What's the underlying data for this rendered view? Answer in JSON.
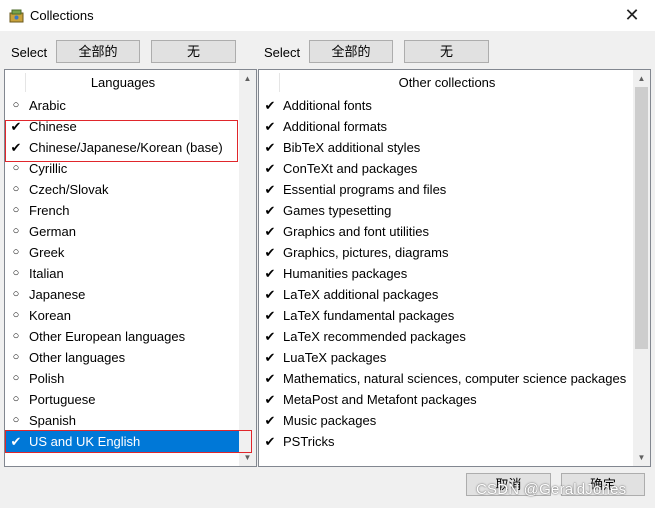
{
  "window": {
    "title": "Collections",
    "close_glyph": "✕"
  },
  "left": {
    "select_label": "Select",
    "select_all_label": "全部的",
    "select_none_label": "无",
    "header": "Languages",
    "items": [
      {
        "label": "Arabic",
        "checked": false,
        "selected": false
      },
      {
        "label": "Chinese",
        "checked": true,
        "selected": false
      },
      {
        "label": "Chinese/Japanese/Korean (base)",
        "checked": true,
        "selected": false
      },
      {
        "label": "Cyrillic",
        "checked": false,
        "selected": false
      },
      {
        "label": "Czech/Slovak",
        "checked": false,
        "selected": false
      },
      {
        "label": "French",
        "checked": false,
        "selected": false
      },
      {
        "label": "German",
        "checked": false,
        "selected": false
      },
      {
        "label": "Greek",
        "checked": false,
        "selected": false
      },
      {
        "label": "Italian",
        "checked": false,
        "selected": false
      },
      {
        "label": "Japanese",
        "checked": false,
        "selected": false
      },
      {
        "label": "Korean",
        "checked": false,
        "selected": false
      },
      {
        "label": "Other European languages",
        "checked": false,
        "selected": false
      },
      {
        "label": "Other languages",
        "checked": false,
        "selected": false
      },
      {
        "label": "Polish",
        "checked": false,
        "selected": false
      },
      {
        "label": "Portuguese",
        "checked": false,
        "selected": false
      },
      {
        "label": "Spanish",
        "checked": false,
        "selected": false
      },
      {
        "label": "US and UK English",
        "checked": true,
        "selected": true
      }
    ]
  },
  "right": {
    "select_label": "Select",
    "select_all_label": "全部的",
    "select_none_label": "无",
    "header": "Other collections",
    "items": [
      {
        "label": "Additional fonts",
        "checked": true
      },
      {
        "label": "Additional formats",
        "checked": true
      },
      {
        "label": "BibTeX additional styles",
        "checked": true
      },
      {
        "label": "ConTeXt and packages",
        "checked": true
      },
      {
        "label": "Essential programs and files",
        "checked": true
      },
      {
        "label": "Games typesetting",
        "checked": true
      },
      {
        "label": "Graphics and font utilities",
        "checked": true
      },
      {
        "label": "Graphics, pictures, diagrams",
        "checked": true
      },
      {
        "label": "Humanities packages",
        "checked": true
      },
      {
        "label": "LaTeX additional packages",
        "checked": true
      },
      {
        "label": "LaTeX fundamental packages",
        "checked": true
      },
      {
        "label": "LaTeX recommended packages",
        "checked": true
      },
      {
        "label": "LuaTeX packages",
        "checked": true
      },
      {
        "label": "Mathematics, natural sciences, computer science packages",
        "checked": true
      },
      {
        "label": "MetaPost and Metafont packages",
        "checked": true
      },
      {
        "label": "Music packages",
        "checked": true
      },
      {
        "label": "PSTricks",
        "checked": true
      }
    ]
  },
  "footer": {
    "cancel_label": "取消",
    "ok_label": "确定"
  },
  "watermark": "CSDN @GeraldJones",
  "marks": {
    "checked": "✔",
    "unchecked": "○"
  },
  "colors": {
    "selection": "#0078d7",
    "highlight_box": "#e0262b"
  }
}
